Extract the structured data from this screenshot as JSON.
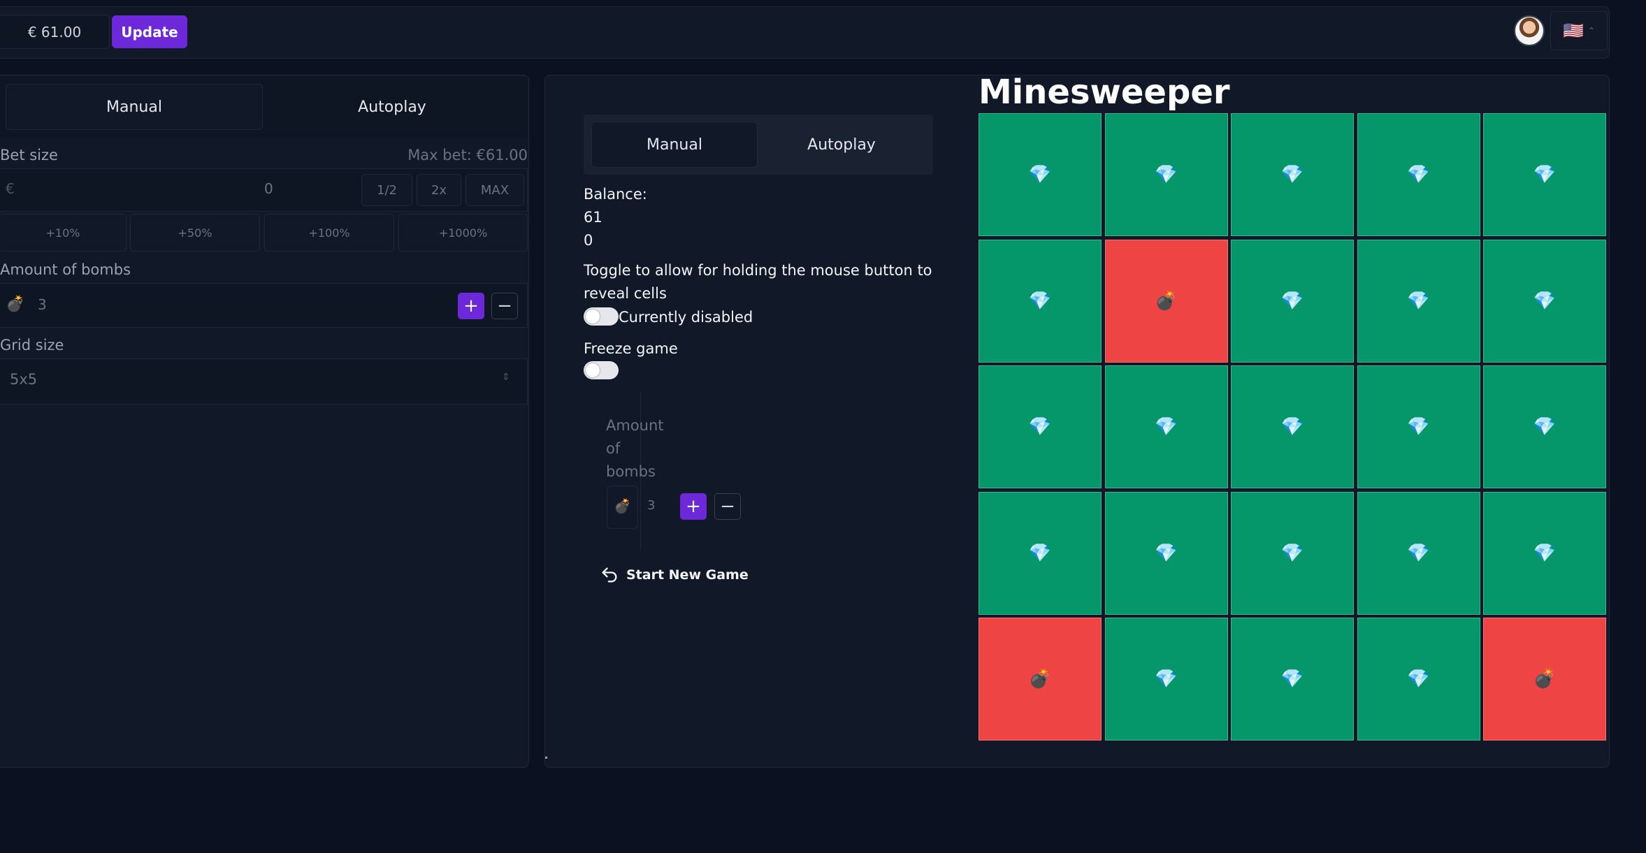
{
  "header": {
    "balance_display": "€ 61.00",
    "update_label": "Update",
    "flag": "🇺🇸",
    "avatar_icon": "user-avatar"
  },
  "left_panel": {
    "tabs": [
      "Manual",
      "Autoplay"
    ],
    "bet_size_label": "Bet size",
    "max_bet_label": "Max bet: €61.00",
    "bet_currency": "€",
    "bet_value": "0",
    "bet_buttons": [
      "1/2",
      "2x",
      "MAX"
    ],
    "percent_buttons": [
      "+10%",
      "+50%",
      "+100%",
      "+1000%"
    ],
    "bombs_label": "Amount of bombs",
    "bombs_icon": "💣",
    "bombs_value": "3",
    "grid_label": "Grid size",
    "grid_value": "5x5"
  },
  "main_panel": {
    "tabs": [
      "Manual",
      "Autoplay"
    ],
    "balance_label": "Balance:",
    "balance_value": "61",
    "second_value": "0",
    "hold_toggle_text": "Toggle to allow for holding the mouse button to reveal cells",
    "hold_toggle_status": "Currently disabled",
    "freeze_label": "Freeze game",
    "sub_bombs_label": "Amount of bombs",
    "sub_bombs_icon": "💣",
    "sub_bombs_value": "3",
    "restart_label": "Start New Game"
  },
  "game": {
    "title": "Minesweeper",
    "grid_size": 5,
    "gem_symbol": "💎",
    "bomb_symbol": "💣",
    "cells": [
      [
        "gem",
        "gem",
        "gem",
        "gem",
        "gem"
      ],
      [
        "gem",
        "bomb",
        "gem",
        "gem",
        "gem"
      ],
      [
        "gem",
        "gem",
        "gem",
        "gem",
        "gem"
      ],
      [
        "gem",
        "gem",
        "gem",
        "gem",
        "gem"
      ],
      [
        "bomb",
        "gem",
        "gem",
        "gem",
        "bomb"
      ]
    ]
  },
  "colors": {
    "accent": "#6d28d9",
    "gem_cell": "#059669",
    "bomb_cell": "#ef4444",
    "background": "#0b1120",
    "panel": "#111827"
  }
}
